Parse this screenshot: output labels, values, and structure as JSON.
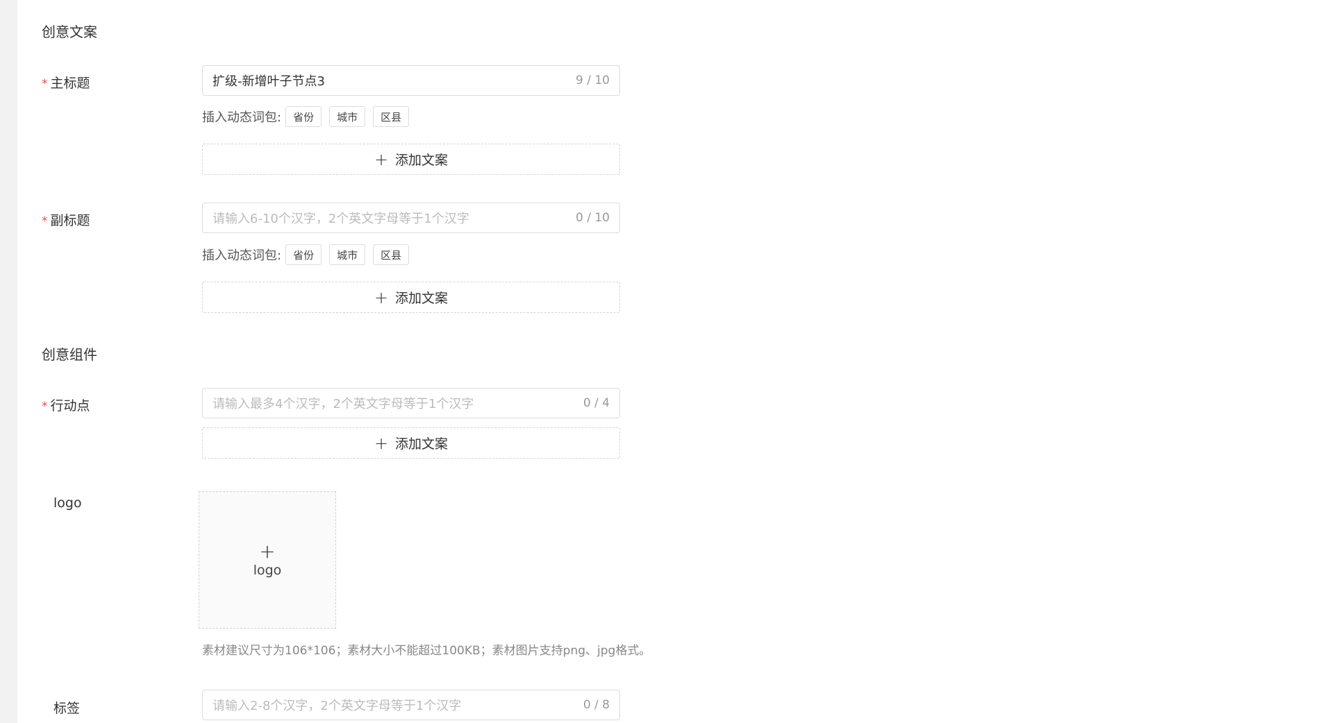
{
  "sections": {
    "copy_title": "创意文案",
    "components_title": "创意组件"
  },
  "main_title": {
    "required_mark": "*",
    "label": "主标题",
    "value": "扩级-新增叶子节点3",
    "counter": "9 / 10",
    "dynamic_label": "插入动态词包:",
    "chips": [
      "省份",
      "城市",
      "区县"
    ],
    "add_label": "添加文案"
  },
  "sub_title": {
    "required_mark": "*",
    "label": "副标题",
    "placeholder": "请输入6-10个汉字，2个英文字母等于1个汉字",
    "counter": "0 / 10",
    "dynamic_label": "插入动态词包:",
    "chips": [
      "省份",
      "城市",
      "区县"
    ],
    "add_label": "添加文案"
  },
  "action_point": {
    "required_mark": "*",
    "label": "行动点",
    "placeholder": "请输入最多4个汉字，2个英文字母等于1个汉字",
    "counter": "0 / 4",
    "add_label": "添加文案"
  },
  "logo": {
    "label": "logo",
    "upload_text": "logo",
    "hint": "素材建议尺寸为106*106；素材大小不能超过100KB；素材图片支持png、jpg格式。"
  },
  "tags": {
    "label": "标签",
    "placeholder": "请输入2-8个汉字，2个英文字母等于1个汉字",
    "counter": "0 / 8"
  },
  "icons": {
    "add": "plus-icon",
    "upload": "plus-icon"
  }
}
